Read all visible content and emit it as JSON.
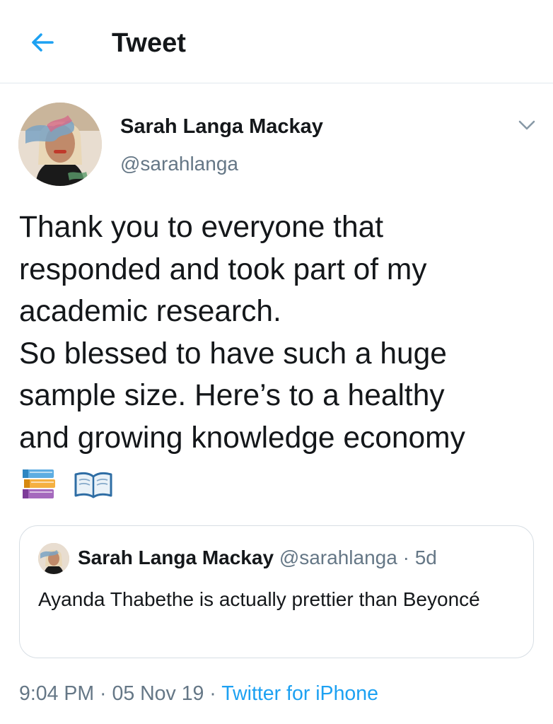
{
  "header": {
    "back_icon": "arrow-left-icon",
    "title": "Tweet",
    "accent_color": "#1DA1F2"
  },
  "tweet": {
    "author_name": "Sarah Langa Mackay",
    "author_handle": "@sarahlanga",
    "menu_icon": "chevron-down-icon",
    "text_lines": [
      "Thank you to everyone that",
      "responded and took part of my",
      "academic research.",
      "So blessed to have such a huge",
      "sample size. Here’s to a healthy",
      "and growing knowledge economy"
    ],
    "emojis": [
      "books-emoji",
      "open-book-emoji"
    ],
    "timestamp": "9:04 PM",
    "separator": " · ",
    "date": "05 Nov 19",
    "source": "Twitter for iPhone"
  },
  "quote": {
    "author_name": "Sarah Langa Mackay",
    "author_handle": "@sarahlanga",
    "separator": " · ",
    "age": "5d",
    "text": "Ayanda Thabethe is actually prettier than Beyoncé"
  }
}
